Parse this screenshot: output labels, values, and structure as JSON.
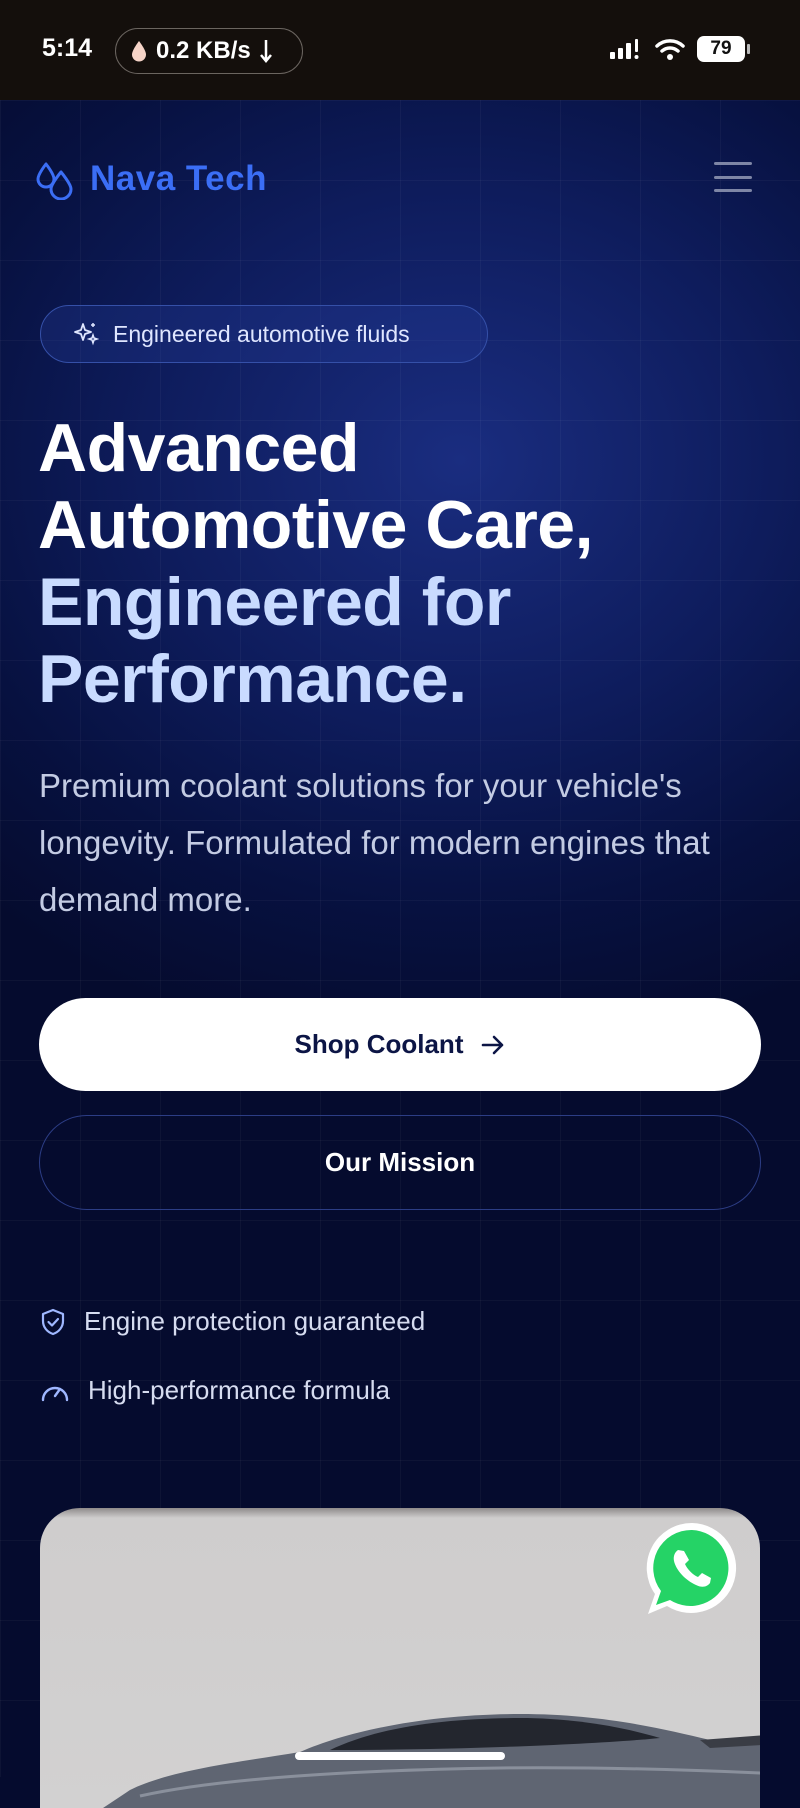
{
  "status_bar": {
    "time": "5:14",
    "network_speed": "0.2 KB/s",
    "battery": "79"
  },
  "header": {
    "brand": "Nava Tech",
    "brand_color": "#3b6ef5",
    "logo_icon": "water-drops-icon",
    "menu_icon": "hamburger-menu-icon"
  },
  "hero": {
    "badge_icon": "sparkles-icon",
    "badge_label": "Engineered automotive fluids",
    "headline_line1": "Advanced",
    "headline_line2": "Automotive Care,",
    "headline_accent_line1": "Engineered for",
    "headline_accent_line2": "Performance.",
    "subtitle": "Premium coolant solutions for your vehicle's longevity. Formulated for modern engines that demand more.",
    "primary_cta": "Shop Coolant",
    "secondary_cta": "Our Mission"
  },
  "features": [
    {
      "icon": "shield-check-icon",
      "label": "Engine protection guaranteed"
    },
    {
      "icon": "gauge-icon",
      "label": "High-performance formula"
    }
  ],
  "floating": {
    "whatsapp_icon": "whatsapp-icon",
    "whatsapp_color": "#25d366"
  },
  "colors": {
    "background": "#050b2e",
    "accent_text": "#c9dbff"
  }
}
